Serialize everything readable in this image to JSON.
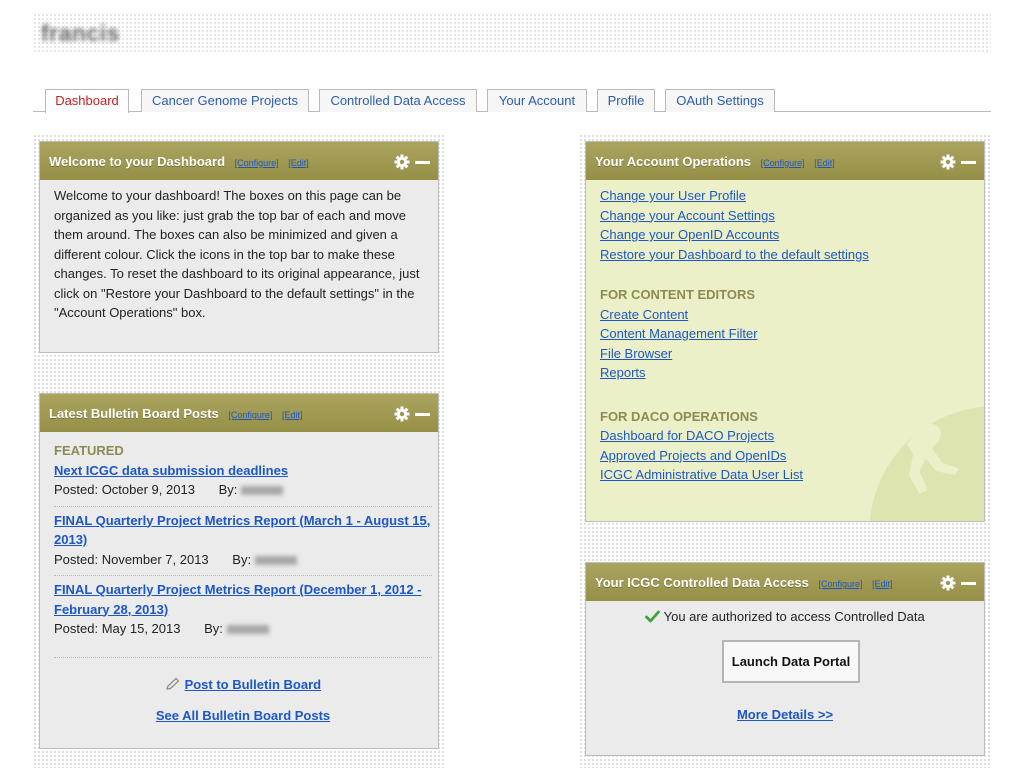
{
  "header": {
    "username": "francis"
  },
  "tabs": [
    {
      "label": "Dashboard",
      "active": true
    },
    {
      "label": "Cancer Genome Projects"
    },
    {
      "label": "Controlled Data Access"
    },
    {
      "label": "Your Account"
    },
    {
      "label": "Profile"
    },
    {
      "label": "OAuth Settings"
    }
  ],
  "panel_common": {
    "configure": "[Configure]",
    "edit": "[Edit]"
  },
  "welcome": {
    "title": "Welcome to your Dashboard",
    "body": "Welcome to your dashboard! The boxes on this page can be organized as you like: just grab the top bar of each and move them around. The boxes can also be minimized and given a different colour. Click the icons in the top bar to make these changes. To reset the dashboard to its original appearance, just click on \"Restore your Dashboard to the default settings\" in the \"Account Operations\" box."
  },
  "bulletin": {
    "title": "Latest Bulletin Board Posts",
    "featured_label": "FEATURED",
    "posts": [
      {
        "title": "Next ICGC data submission deadlines",
        "posted": "Posted: October 9, 2013",
        "by_label": "By:",
        "by": "francis"
      },
      {
        "title": "FINAL Quarterly Project Metrics Report (March 1 - August 15, 2013)",
        "posted": "Posted: November 7, 2013",
        "by_label": "By:",
        "by": "jmnoted"
      },
      {
        "title": "FINAL Quarterly Project Metrics Report (December 1, 2012 - February 28, 2013)",
        "posted": "Posted: May 15, 2013",
        "by_label": "By:",
        "by": "jmnoted"
      }
    ],
    "post_link": "Post to Bulletin Board",
    "see_all": "See All Bulletin Board Posts"
  },
  "account_ops": {
    "title": "Your Account Operations",
    "links": [
      "Change your User Profile",
      "Change your Account Settings",
      "Change your OpenID Accounts",
      "Restore your Dashboard to the default settings"
    ],
    "content_editors_heading": "FOR CONTENT EDITORS",
    "content_links": [
      "Create Content",
      "Content Management Filter",
      "File Browser",
      "Reports"
    ],
    "daco_heading": "FOR DACO OPERATIONS",
    "daco_links": [
      "Dashboard for DACO Projects",
      "Approved Projects and OpenIDs",
      "ICGC Administrative Data User List"
    ]
  },
  "controlled": {
    "title": "Your ICGC Controlled Data Access",
    "status": "You are authorized to access Controlled Data",
    "launch": "Launch Data Portal",
    "more": "More Details >>"
  },
  "colors": {
    "panel_header": "#9f9953",
    "link": "#1d57c6",
    "active_tab": "#c81e1e",
    "section_heading": "#8d8a52",
    "check": "#3aa637"
  }
}
